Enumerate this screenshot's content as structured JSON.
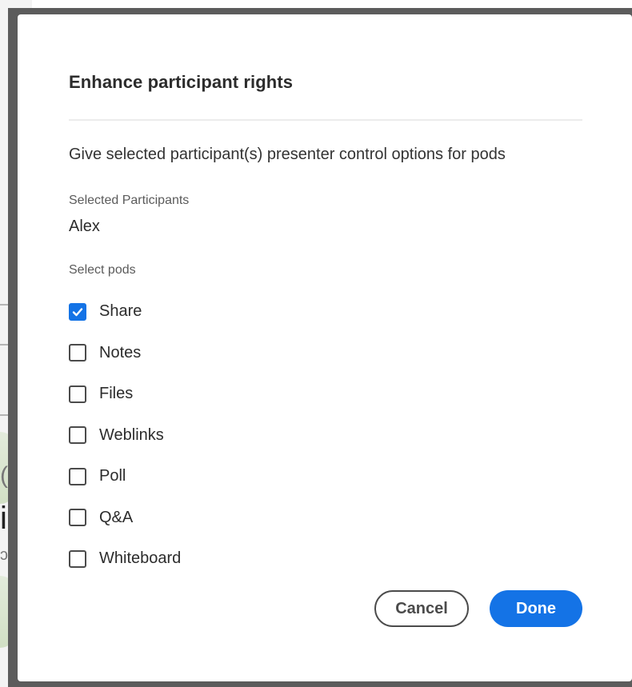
{
  "dialog": {
    "title": "Enhance participant rights",
    "description": "Give selected participant(s) presenter control options for pods",
    "selected_participants_label": "Selected Participants",
    "selected_participants_value": "Alex",
    "select_pods_label": "Select pods",
    "pods": [
      {
        "label": "Share",
        "checked": true
      },
      {
        "label": "Notes",
        "checked": false
      },
      {
        "label": "Files",
        "checked": false
      },
      {
        "label": "Weblinks",
        "checked": false
      },
      {
        "label": "Poll",
        "checked": false
      },
      {
        "label": "Q&A",
        "checked": false
      },
      {
        "label": "Whiteboard",
        "checked": false
      }
    ],
    "cancel_label": "Cancel",
    "done_label": "Done"
  },
  "background": {
    "glyph_1": "(",
    "glyph_2": "i",
    "glyph_3": "ɔ"
  },
  "colors": {
    "accent": "#1473e6",
    "frame": "#5c5c5c",
    "text": "#2c2c2c"
  },
  "icons": {
    "checkbox_checked": "checkmark-icon"
  }
}
